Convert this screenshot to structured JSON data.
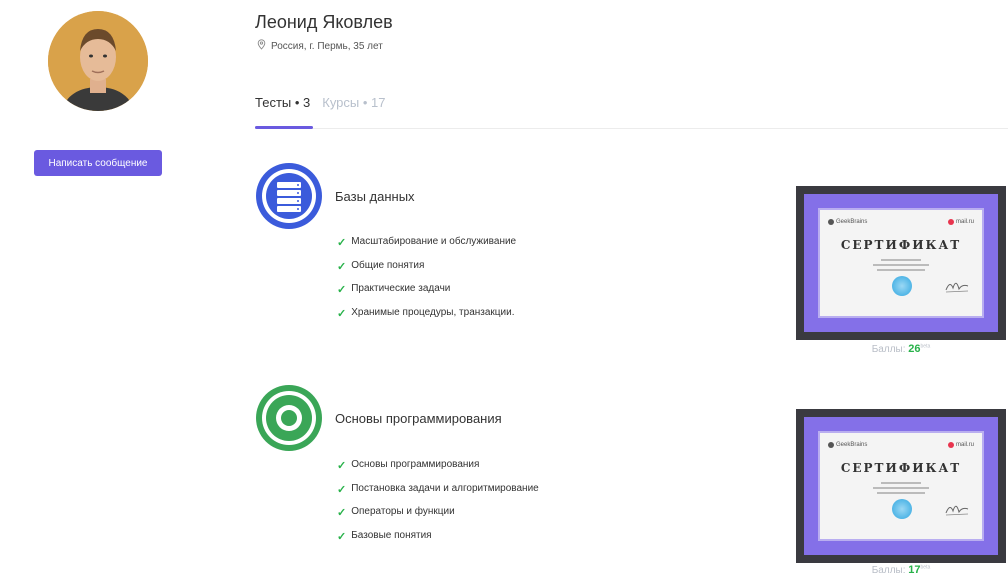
{
  "profile": {
    "name": "Леонид Яковлев",
    "location": "Россия, г. Пермь, 35 лет",
    "message_button": "Написать сообщение"
  },
  "tabs": [
    {
      "label": "Тесты • 3",
      "active": true
    },
    {
      "label": "Курсы • 17",
      "active": false
    }
  ],
  "courses": [
    {
      "title": "Базы данных",
      "icon": "database-icon",
      "color": "#3b5bdb",
      "topics": [
        "Масштабирование и обслуживание",
        "Общие понятия",
        "Практические задачи",
        "Хранимые процедуры, транзакции."
      ],
      "certificate": {
        "heading": "СЕРТИФИКАТ",
        "brand_left": "GeekBrains",
        "brand_right": "mail.ru",
        "score_label": "Баллы:",
        "score_value": "26",
        "score_suffix": "beta"
      }
    },
    {
      "title": "Основы программирования",
      "icon": "target-icon",
      "color": "#3aa657",
      "topics": [
        "Основы программирования",
        "Постановка задачи и алгоритмирование",
        "Операторы и функции",
        "Базовые понятия"
      ],
      "certificate": {
        "heading": "СЕРТИФИКАТ",
        "brand_left": "GeekBrains",
        "brand_right": "mail.ru",
        "score_label": "Баллы:",
        "score_value": "17",
        "score_suffix": "beta"
      }
    }
  ],
  "colors": {
    "accent": "#6a5ae0",
    "check": "#28b24a",
    "inactive_tab": "#b8c0cc"
  }
}
